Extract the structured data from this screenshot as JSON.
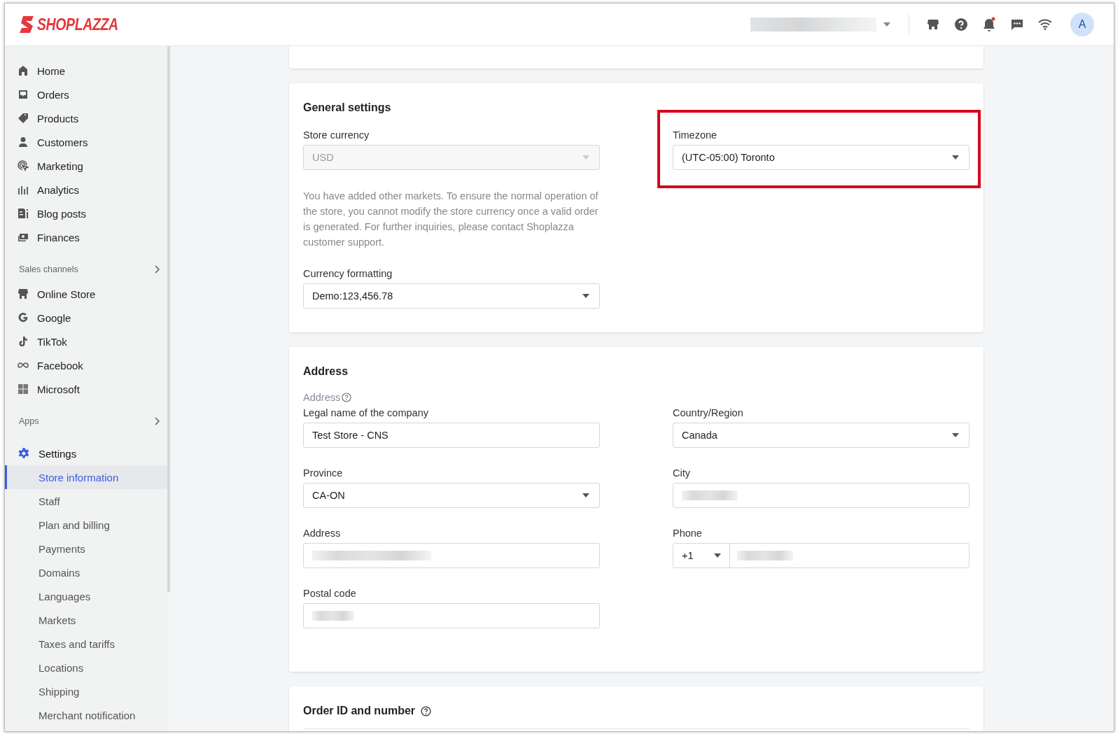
{
  "header": {
    "logo": "SHOPLAZZA",
    "avatar": "A",
    "notification_dot": true
  },
  "sidebar": {
    "main": [
      {
        "label": "Home"
      },
      {
        "label": "Orders"
      },
      {
        "label": "Products"
      },
      {
        "label": "Customers"
      },
      {
        "label": "Marketing"
      },
      {
        "label": "Analytics"
      },
      {
        "label": "Blog posts"
      },
      {
        "label": "Finances"
      }
    ],
    "sales_channels": {
      "title": "Sales channels",
      "items": [
        {
          "label": "Online Store"
        },
        {
          "label": "Google"
        },
        {
          "label": "TikTok"
        },
        {
          "label": "Facebook"
        },
        {
          "label": "Microsoft"
        }
      ]
    },
    "apps": {
      "title": "Apps"
    },
    "settings": {
      "label": "Settings",
      "expanded": true,
      "children": [
        {
          "label": "Store information",
          "selected": true
        },
        {
          "label": "Staff",
          "selected": false
        },
        {
          "label": "Plan and billing",
          "selected": false
        },
        {
          "label": "Payments",
          "selected": false
        },
        {
          "label": "Domains",
          "selected": false
        },
        {
          "label": "Languages",
          "selected": false
        },
        {
          "label": "Markets",
          "selected": false
        },
        {
          "label": "Taxes and tariffs",
          "selected": false
        },
        {
          "label": "Locations",
          "selected": false
        },
        {
          "label": "Shipping",
          "selected": false
        },
        {
          "label": "Merchant notification",
          "selected": false
        }
      ]
    }
  },
  "general_settings": {
    "title": "General settings",
    "store_currency": {
      "label": "Store currency",
      "value": "USD",
      "disabled": true
    },
    "currency_note": "You have added other markets. To ensure the normal operation of the store, you cannot modify the store currency once a valid order is generated. For further inquiries, please contact Shoplazza customer support.",
    "currency_formatting": {
      "label": "Currency formatting",
      "value": "Demo:123,456.78",
      "disabled": false
    },
    "timezone": {
      "label": "Timezone",
      "value": "(UTC-05:00) Toronto",
      "highlighted": true
    }
  },
  "address": {
    "title": "Address",
    "subtitle": "Address",
    "left": [
      {
        "kind": "text",
        "label": "Legal name of the company",
        "value": "Test Store - CNS"
      },
      {
        "kind": "select",
        "label": "Province",
        "value": "CA-ON"
      },
      {
        "kind": "blurred",
        "label": "Address"
      },
      {
        "kind": "blurred",
        "label": "Postal code"
      }
    ],
    "right": [
      {
        "kind": "select",
        "label": "Country/Region",
        "value": "Canada"
      },
      {
        "kind": "blurred",
        "label": "City"
      },
      {
        "kind": "phone",
        "label": "Phone",
        "value": "+1"
      }
    ]
  },
  "order_id": {
    "title": "Order ID and number"
  }
}
